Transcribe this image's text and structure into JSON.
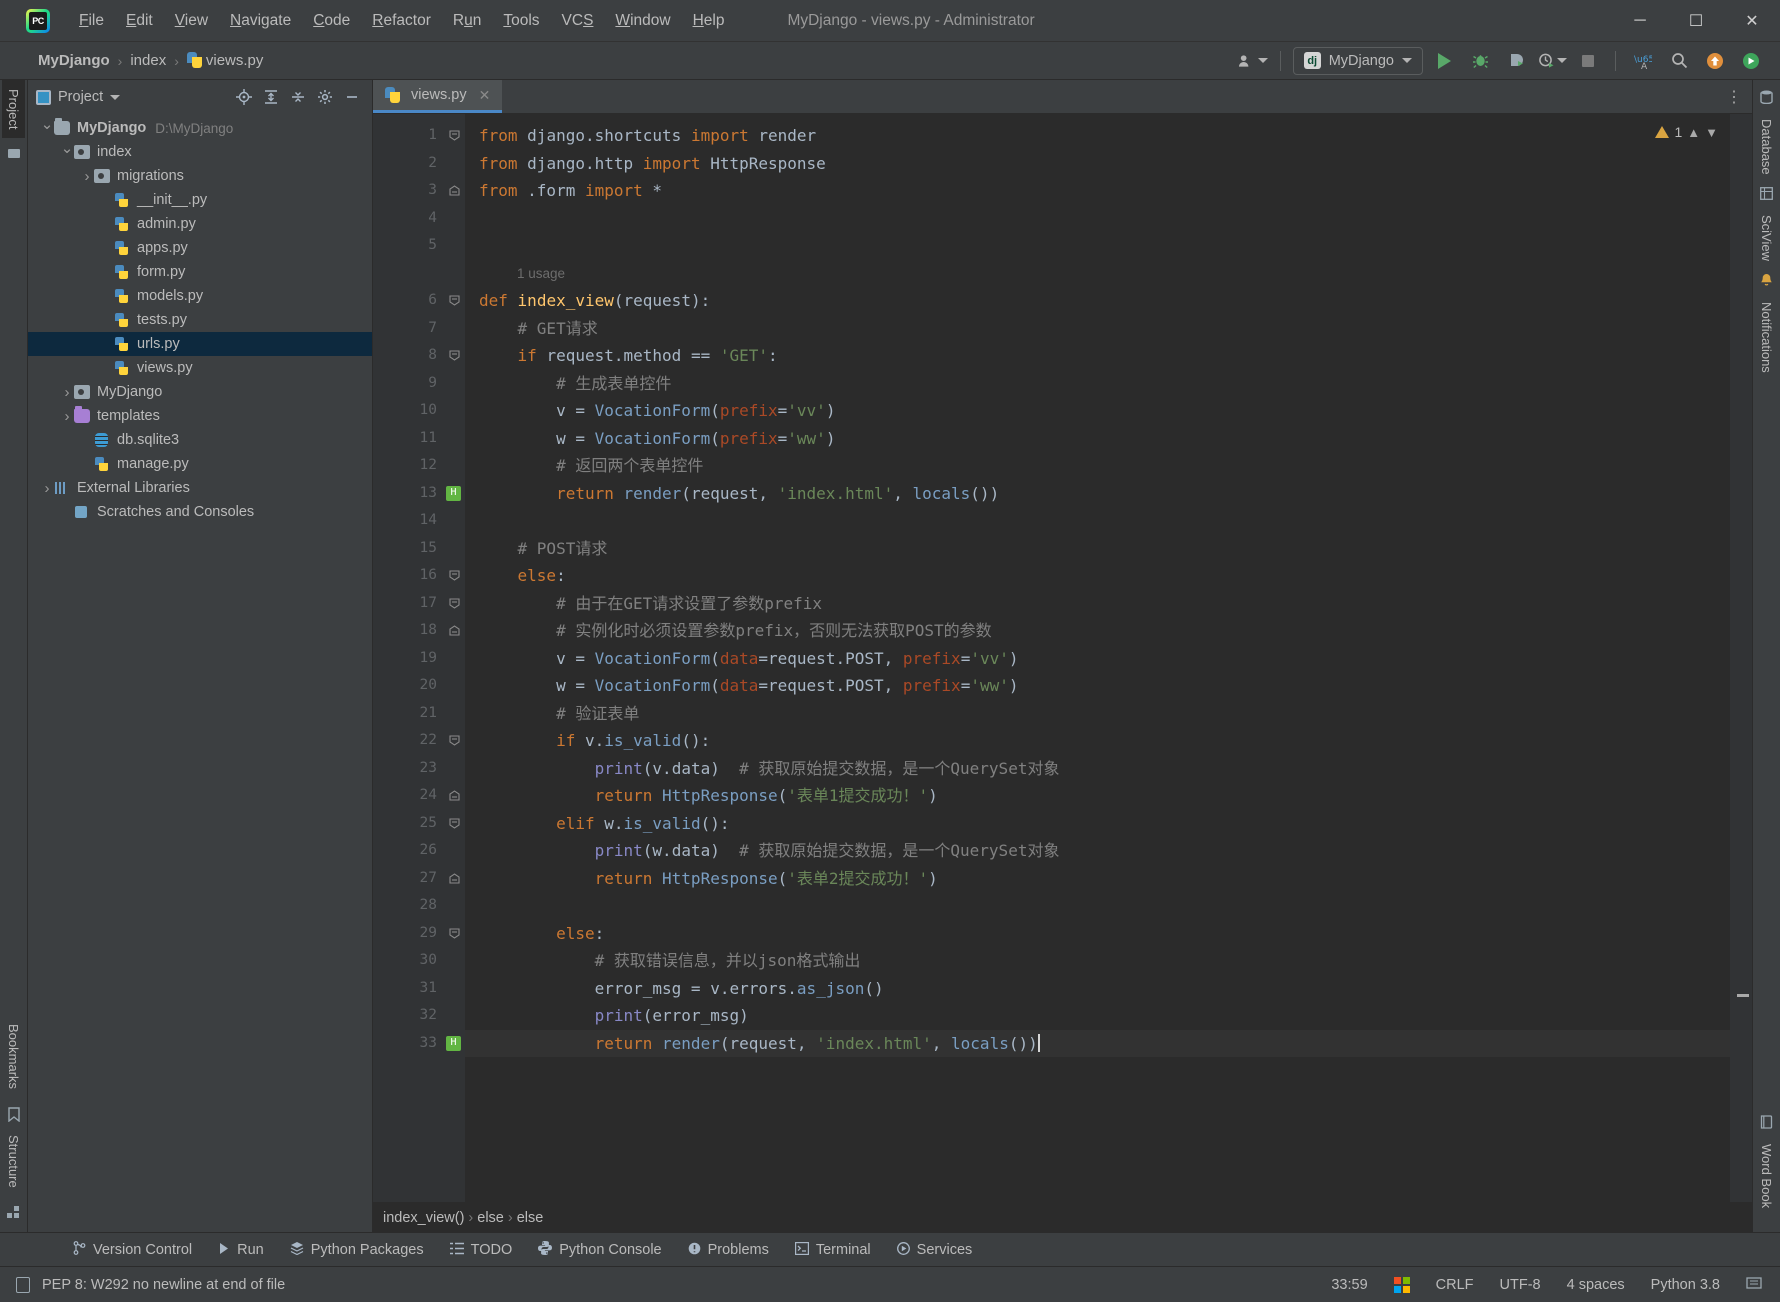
{
  "titlebar": {
    "logo_name": "pycharm-logo",
    "window_title": "MyDjango - views.py - Administrator",
    "menus": [
      "File",
      "Edit",
      "View",
      "Navigate",
      "Code",
      "Refactor",
      "Run",
      "Tools",
      "VCS",
      "Window",
      "Help"
    ],
    "minimize": "─",
    "maximize": "☐",
    "close": "✕"
  },
  "navbar": {
    "crumbs": [
      "MyDjango",
      "index",
      "views.py"
    ],
    "separator": "›",
    "run_config": {
      "label": "MyDjango",
      "badge": "dj"
    },
    "icons": [
      "user-icon",
      "run-icon",
      "debug-icon",
      "coverage-icon",
      "profile-icon",
      "stop-icon",
      "translate-icon",
      "search-icon",
      "update-icon",
      "plugin-icon"
    ]
  },
  "project_panel": {
    "title": "Project",
    "actions": [
      "locate-icon",
      "expand-all-icon",
      "collapse-all-icon",
      "settings-icon",
      "hide-icon"
    ],
    "tree": [
      {
        "label": "MyDjango",
        "path": "D:\\MyDjango",
        "indent": 0,
        "arrow": "open",
        "icon": "folder",
        "bold": true,
        "selected": false
      },
      {
        "label": "index",
        "path": "",
        "indent": 1,
        "arrow": "open",
        "icon": "module",
        "bold": false,
        "selected": false
      },
      {
        "label": "migrations",
        "path": "",
        "indent": 2,
        "arrow": "closed",
        "icon": "module",
        "bold": false,
        "selected": false
      },
      {
        "label": "__init__.py",
        "path": "",
        "indent": 3,
        "arrow": "none",
        "icon": "py",
        "bold": false,
        "selected": false
      },
      {
        "label": "admin.py",
        "path": "",
        "indent": 3,
        "arrow": "none",
        "icon": "py",
        "bold": false,
        "selected": false
      },
      {
        "label": "apps.py",
        "path": "",
        "indent": 3,
        "arrow": "none",
        "icon": "py",
        "bold": false,
        "selected": false
      },
      {
        "label": "form.py",
        "path": "",
        "indent": 3,
        "arrow": "none",
        "icon": "py",
        "bold": false,
        "selected": false
      },
      {
        "label": "models.py",
        "path": "",
        "indent": 3,
        "arrow": "none",
        "icon": "py",
        "bold": false,
        "selected": false
      },
      {
        "label": "tests.py",
        "path": "",
        "indent": 3,
        "arrow": "none",
        "icon": "py",
        "bold": false,
        "selected": false
      },
      {
        "label": "urls.py",
        "path": "",
        "indent": 3,
        "arrow": "none",
        "icon": "py",
        "bold": false,
        "selected": true
      },
      {
        "label": "views.py",
        "path": "",
        "indent": 3,
        "arrow": "none",
        "icon": "py",
        "bold": false,
        "selected": false
      },
      {
        "label": "MyDjango",
        "path": "",
        "indent": 1,
        "arrow": "closed",
        "icon": "module",
        "bold": false,
        "selected": false
      },
      {
        "label": "templates",
        "path": "",
        "indent": 1,
        "arrow": "closed",
        "icon": "tmpl",
        "bold": false,
        "selected": false
      },
      {
        "label": "db.sqlite3",
        "path": "",
        "indent": 2,
        "arrow": "none",
        "icon": "db",
        "bold": false,
        "selected": false
      },
      {
        "label": "manage.py",
        "path": "",
        "indent": 2,
        "arrow": "none",
        "icon": "py",
        "bold": false,
        "selected": false
      },
      {
        "label": "External Libraries",
        "path": "",
        "indent": 0,
        "arrow": "closed",
        "icon": "lib",
        "bold": false,
        "selected": false
      },
      {
        "label": "Scratches and Consoles",
        "path": "",
        "indent": 1,
        "arrow": "none",
        "icon": "scr",
        "bold": false,
        "selected": false
      }
    ]
  },
  "left_rail": {
    "top_tab": "Project",
    "bottom_tabs": [
      "Bookmarks",
      "Structure"
    ]
  },
  "right_rail": {
    "tabs": [
      "Database",
      "SciView",
      "Notifications",
      "Word Book"
    ]
  },
  "editor": {
    "tab_label": "views.py",
    "tab_close": "✕",
    "inspection_count": "1",
    "usage_note": "1 usage",
    "crumbs": [
      "index_view()",
      "else",
      "else"
    ],
    "crumb_sep": "›",
    "lines": [
      {
        "n": "1",
        "bookmark": false,
        "fold": "open",
        "current": false
      },
      {
        "n": "2",
        "bookmark": false,
        "fold": "",
        "current": false
      },
      {
        "n": "3",
        "bookmark": false,
        "fold": "close",
        "current": false
      },
      {
        "n": "4",
        "bookmark": false,
        "fold": "",
        "current": false
      },
      {
        "n": "5",
        "bookmark": false,
        "fold": "",
        "current": false
      },
      {
        "n": "",
        "bookmark": false,
        "fold": "",
        "current": false
      },
      {
        "n": "6",
        "bookmark": false,
        "fold": "open",
        "current": false
      },
      {
        "n": "7",
        "bookmark": false,
        "fold": "",
        "current": false
      },
      {
        "n": "8",
        "bookmark": false,
        "fold": "open",
        "current": false
      },
      {
        "n": "9",
        "bookmark": false,
        "fold": "",
        "current": false
      },
      {
        "n": "10",
        "bookmark": false,
        "fold": "",
        "current": false
      },
      {
        "n": "11",
        "bookmark": false,
        "fold": "",
        "current": false
      },
      {
        "n": "12",
        "bookmark": false,
        "fold": "",
        "current": false
      },
      {
        "n": "13",
        "bookmark": true,
        "fold": "close",
        "current": false
      },
      {
        "n": "14",
        "bookmark": false,
        "fold": "",
        "current": false
      },
      {
        "n": "15",
        "bookmark": false,
        "fold": "",
        "current": false
      },
      {
        "n": "16",
        "bookmark": false,
        "fold": "open",
        "current": false
      },
      {
        "n": "17",
        "bookmark": false,
        "fold": "open",
        "current": false
      },
      {
        "n": "18",
        "bookmark": false,
        "fold": "close",
        "current": false
      },
      {
        "n": "19",
        "bookmark": false,
        "fold": "",
        "current": false
      },
      {
        "n": "20",
        "bookmark": false,
        "fold": "",
        "current": false
      },
      {
        "n": "21",
        "bookmark": false,
        "fold": "",
        "current": false
      },
      {
        "n": "22",
        "bookmark": false,
        "fold": "open",
        "current": false
      },
      {
        "n": "23",
        "bookmark": false,
        "fold": "",
        "current": false
      },
      {
        "n": "24",
        "bookmark": false,
        "fold": "close",
        "current": false
      },
      {
        "n": "25",
        "bookmark": false,
        "fold": "open",
        "current": false
      },
      {
        "n": "26",
        "bookmark": false,
        "fold": "",
        "current": false
      },
      {
        "n": "27",
        "bookmark": false,
        "fold": "close",
        "current": false
      },
      {
        "n": "28",
        "bookmark": false,
        "fold": "",
        "current": false
      },
      {
        "n": "29",
        "bookmark": false,
        "fold": "open",
        "current": false
      },
      {
        "n": "30",
        "bookmark": false,
        "fold": "",
        "current": false
      },
      {
        "n": "31",
        "bookmark": false,
        "fold": "",
        "current": false
      },
      {
        "n": "32",
        "bookmark": false,
        "fold": "",
        "current": false
      },
      {
        "n": "33",
        "bookmark": true,
        "fold": "close",
        "current": true
      }
    ],
    "source": [
      "from django.shortcuts import render",
      "from django.http import HttpResponse",
      "from .form import *",
      "",
      "",
      "",
      "def index_view(request):",
      "    # GET请求",
      "    if request.method == 'GET':",
      "        # 生成表单控件",
      "        v = VocationForm(prefix='vv')",
      "        w = VocationForm(prefix='ww')",
      "        # 返回两个表单控件",
      "        return render(request, 'index.html', locals())",
      "",
      "    # POST请求",
      "    else:",
      "        # 由于在GET请求设置了参数prefix",
      "        # 实例化时必须设置参数prefix，否则无法获取POST的参数",
      "        v = VocationForm(data=request.POST, prefix='vv')",
      "        w = VocationForm(data=request.POST, prefix='ww')",
      "        # 验证表单",
      "        if v.is_valid():",
      "            print(v.data)  # 获取原始提交数据，是一个QuerySet对象",
      "            return HttpResponse('表单1提交成功！')",
      "        elif w.is_valid():",
      "            print(w.data)  # 获取原始提交数据，是一个QuerySet对象",
      "            return HttpResponse('表单2提交成功！')",
      "",
      "        else:",
      "            # 获取错误信息，并以json格式输出",
      "            error_msg = v.errors.as_json()",
      "            print(error_msg)",
      "            return render(request, 'index.html', locals())"
    ]
  },
  "bottom_toolwindows": [
    {
      "label": "Version Control",
      "icon": "branch-icon"
    },
    {
      "label": "Run",
      "icon": "run-icon"
    },
    {
      "label": "Python Packages",
      "icon": "packages-icon"
    },
    {
      "label": "TODO",
      "icon": "todo-icon"
    },
    {
      "label": "Python Console",
      "icon": "python-icon"
    },
    {
      "label": "Problems",
      "icon": "problems-icon"
    },
    {
      "label": "Terminal",
      "icon": "terminal-icon"
    },
    {
      "label": "Services",
      "icon": "services-icon"
    }
  ],
  "statusbar": {
    "message": "PEP 8: W292 no newline at end of file",
    "caret_position": "33:59",
    "line_separator": "CRLF",
    "encoding": "UTF-8",
    "indent": "4 spaces",
    "interpreter": "Python 3.8"
  },
  "colors": {
    "accent": "#4a88c7",
    "selection": "#0d293e",
    "panel": "#3c3f41",
    "editor_bg": "#2b2b2b",
    "gutter_bg": "#313335",
    "green": "#59a869",
    "warning": "#d9a441"
  }
}
